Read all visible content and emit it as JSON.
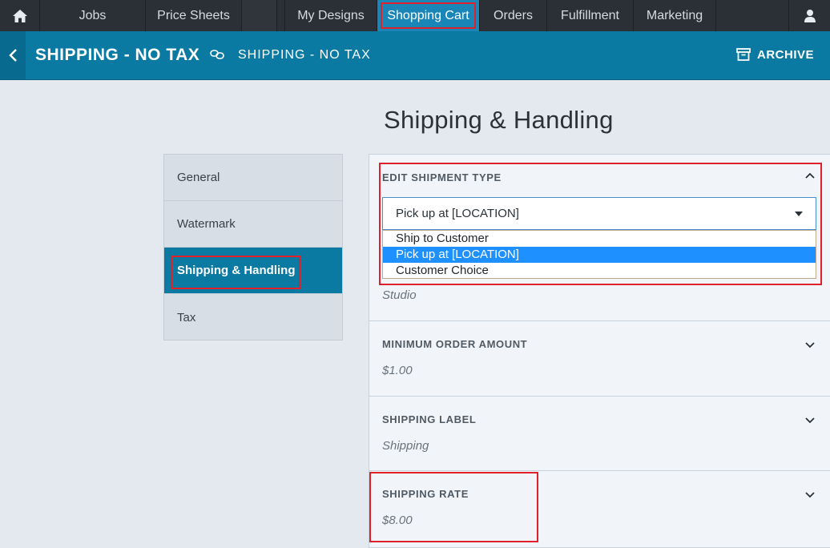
{
  "nav": {
    "home_icon": "home-icon",
    "items": [
      "Jobs",
      "Price Sheets",
      "My Designs",
      "Shopping Cart",
      "Orders",
      "Fulfillment",
      "Marketing"
    ],
    "user_icon": "user-icon"
  },
  "titlebar": {
    "title": "SHIPPING - NO TAX",
    "subtitle": "SHIPPING - NO TAX",
    "archive_label": "ARCHIVE"
  },
  "page": {
    "heading": "Shipping & Handling"
  },
  "sidetabs": [
    "General",
    "Watermark",
    "Shipping & Handling",
    "Tax"
  ],
  "edit_shipment": {
    "label": "EDIT SHIPMENT TYPE",
    "selected": "Pick up at [LOCATION]",
    "options": [
      "Ship to Customer",
      "Pick up at [LOCATION]",
      "Customer Choice"
    ]
  },
  "location": {
    "value": "Studio"
  },
  "min_order": {
    "label": "MINIMUM ORDER AMOUNT",
    "value": "$1.00"
  },
  "shipping_label": {
    "label": "SHIPPING LABEL",
    "value": "Shipping"
  },
  "shipping_rate": {
    "label": "SHIPPING RATE",
    "value": "$8.00"
  },
  "colors": {
    "nav_bg": "#2b3036",
    "accent": "#0a7aa3",
    "highlight": "#e0202a",
    "selected_option": "#1e90ff"
  }
}
